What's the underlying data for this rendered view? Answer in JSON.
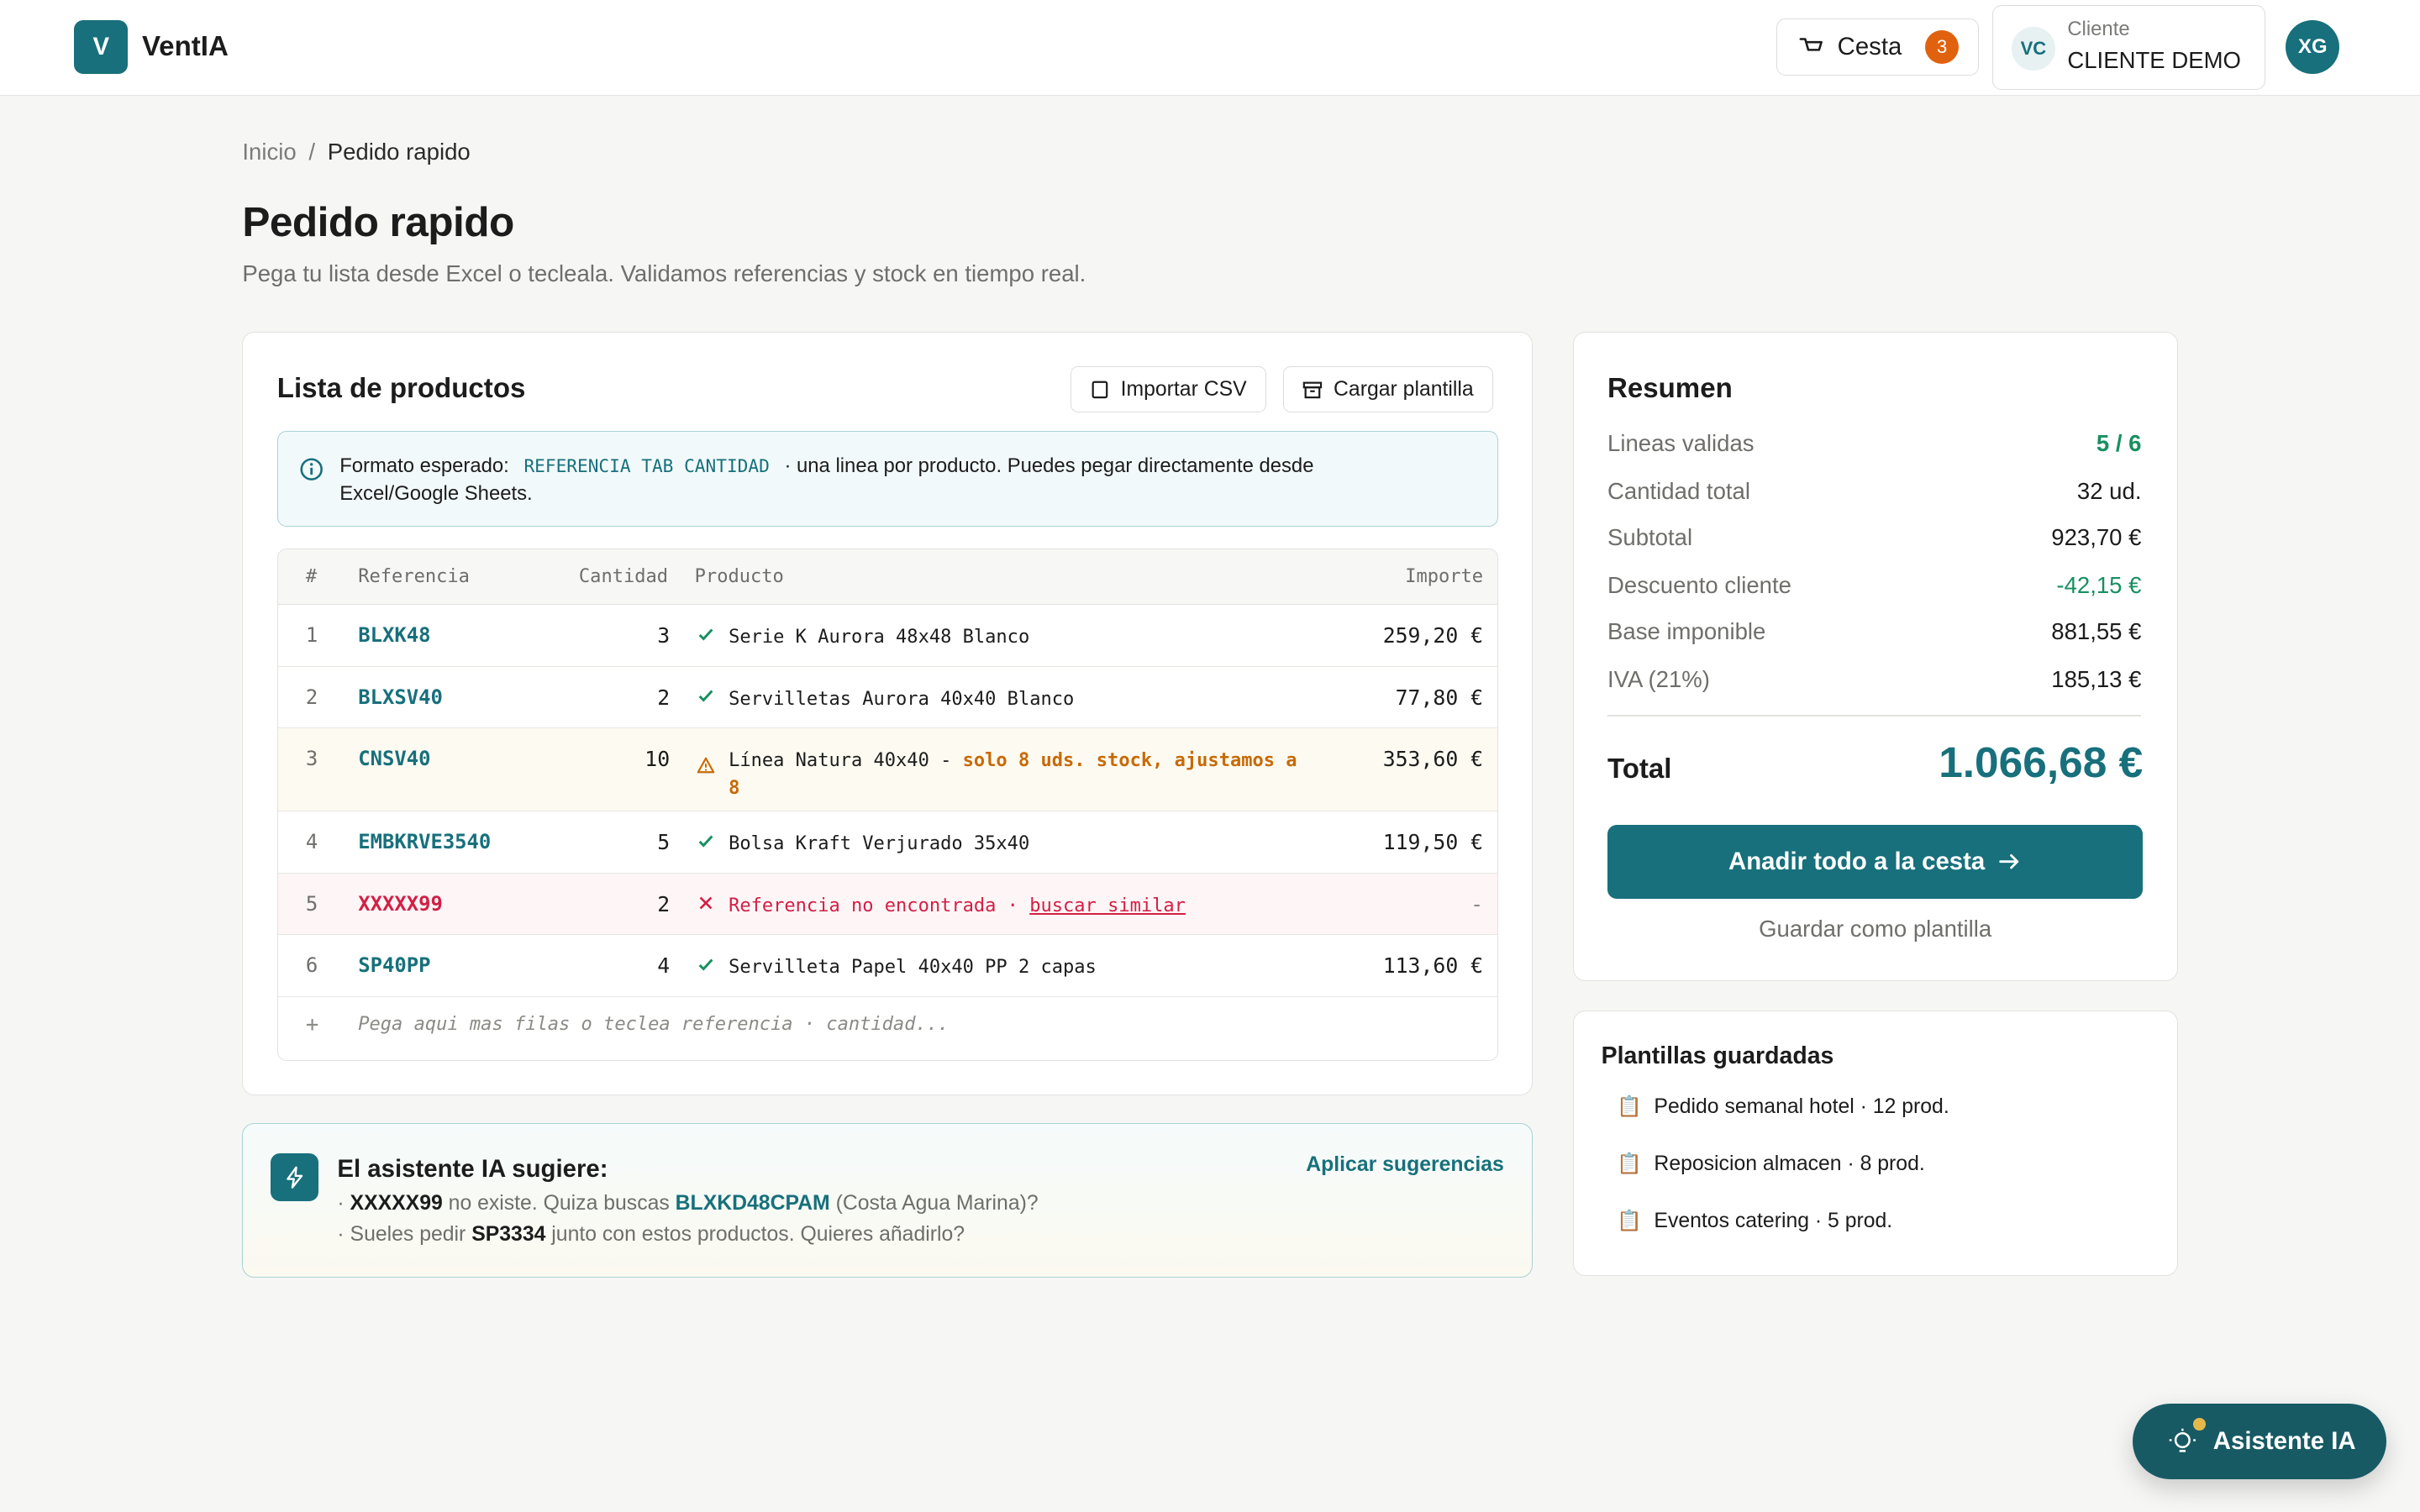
{
  "header": {
    "logo_letter": "V",
    "app_name": "VentIA",
    "cart_label": "Cesta",
    "cart_count": "3",
    "client_initials": "VC",
    "client_caption": "Cliente",
    "client_name": "CLIENTE DEMO",
    "user_initials": "XG"
  },
  "breadcrumb": {
    "home": "Inicio",
    "separator": "/",
    "current": "Pedido rapido"
  },
  "page": {
    "title": "Pedido rapido",
    "subtitle": "Pega tu lista desde Excel o tecleala. Validamos referencias y stock en tiempo real."
  },
  "products": {
    "title": "Lista de productos",
    "import_csv": "Importar CSV",
    "load_template": "Cargar plantilla",
    "info_prefix": "Formato esperado:",
    "info_code": "REFERENCIA TAB CANTIDAD",
    "info_suffix": "· una linea por producto. Puedes pegar directamente desde Excel/Google Sheets.",
    "columns": {
      "num": "#",
      "ref": "Referencia",
      "qty": "Cantidad",
      "product": "Producto",
      "amount": "Importe"
    },
    "rows": [
      {
        "num": "1",
        "ref": "BLXK48",
        "qty": "3",
        "product": "Serie K Aurora 48x48 Blanco",
        "amount": "259,20 €",
        "status": "ok"
      },
      {
        "num": "2",
        "ref": "BLXSV40",
        "qty": "2",
        "product": "Servilletas Aurora 40x40 Blanco",
        "amount": "77,80 €",
        "status": "ok"
      },
      {
        "num": "3",
        "ref": "CNSV40",
        "qty": "10",
        "product": "Línea Natura 40x40 -",
        "warning": "solo 8 uds. stock, ajustamos a 8",
        "amount": "353,60 €",
        "status": "warn"
      },
      {
        "num": "4",
        "ref": "EMBKRVE3540",
        "qty": "5",
        "product": "Bolsa Kraft Verjurado 35x40",
        "amount": "119,50 €",
        "status": "ok"
      },
      {
        "num": "5",
        "ref": "XXXXX99",
        "qty": "2",
        "product": "Referencia no encontrada ·",
        "link": "buscar similar",
        "amount": "-",
        "status": "error"
      },
      {
        "num": "6",
        "ref": "SP40PP",
        "qty": "4",
        "product": "Servilleta Papel 40x40 PP 2 capas",
        "amount": "113,60 €",
        "status": "ok"
      }
    ],
    "add_symbol": "+",
    "add_placeholder": "Pega aqui mas filas o teclea referencia · cantidad..."
  },
  "ai": {
    "title": "El asistente IA sugiere:",
    "apply": "Aplicar sugerencias",
    "line1": {
      "bullet": "·",
      "ref": "XXXXX99",
      "mid": "no existe. Quiza buscas",
      "alt_ref": "BLXKD48CPAM",
      "tail": "(Costa Agua Marina)?"
    },
    "line2": {
      "bullet": "·",
      "pre": "Sueles pedir",
      "ref": "SP3334",
      "tail": "junto con estos productos. Quieres añadirlo?"
    }
  },
  "summary": {
    "title": "Resumen",
    "rows": [
      {
        "label": "Lineas validas",
        "value": "5 / 6"
      },
      {
        "label": "Cantidad total",
        "value": "32 ud."
      },
      {
        "label": "Subtotal",
        "value": "923,70 €"
      },
      {
        "label": "Descuento cliente",
        "value": "-42,15 €"
      },
      {
        "label": "Base imponible",
        "value": "881,55 €"
      },
      {
        "label": "IVA (21%)",
        "value": "185,13 €"
      }
    ],
    "total_label": "Total",
    "total_value": "1.066,68 €",
    "add_all": "Anadir todo a la cesta",
    "save_template": "Guardar como plantilla"
  },
  "templates": {
    "title": "Plantillas guardadas",
    "items": [
      {
        "label": "Pedido semanal hotel · 12 prod."
      },
      {
        "label": "Reposicion almacen · 8 prod."
      },
      {
        "label": "Eventos catering · 5 prod."
      }
    ]
  },
  "assistant_fab": "Asistente IA",
  "colors": {
    "accent": "#17707c",
    "badge": "#e0620f",
    "success": "#179060",
    "warning": "#c76a07",
    "error": "#d31f45"
  }
}
